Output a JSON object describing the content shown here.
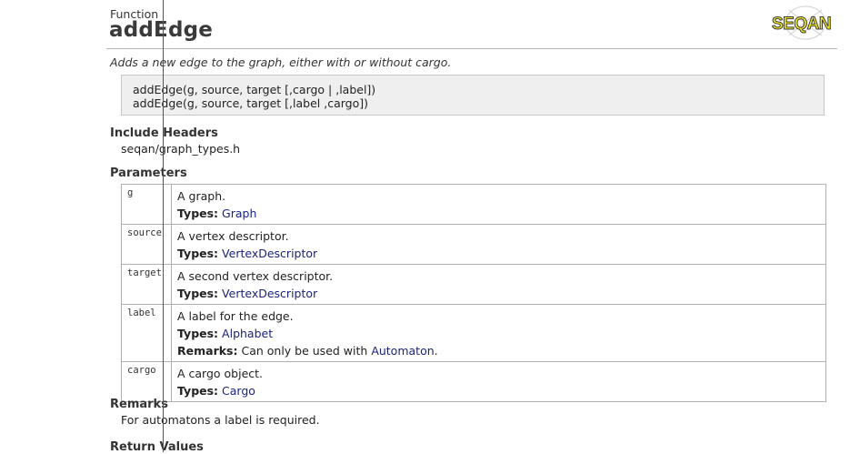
{
  "header": {
    "kind": "Function",
    "title": "addEdge",
    "logo_text": "SEQAN"
  },
  "summary": "Adds a new edge to the graph, either with or without cargo.",
  "signatures": [
    "addEdge(g, source, target [,cargo | ,label])",
    "addEdge(g, source, target [,label ,cargo])"
  ],
  "include": {
    "heading": "Include Headers",
    "file": "seqan/graph_types.h"
  },
  "parameters": {
    "heading": "Parameters",
    "types_label": "Types:",
    "remarks_label": "Remarks:",
    "rows": [
      {
        "name": "g",
        "desc": "A graph.",
        "type": "Graph"
      },
      {
        "name": "source",
        "desc": "A vertex descriptor.",
        "type": "VertexDescriptor"
      },
      {
        "name": "target",
        "desc": "A second vertex descriptor.",
        "type": "VertexDescriptor"
      },
      {
        "name": "label",
        "desc": "A label for the edge.",
        "type": "Alphabet",
        "remark_text": "Can only be used with",
        "remark_link": "Automaton",
        "remark_end": "."
      },
      {
        "name": "cargo",
        "desc": "A cargo object.",
        "type": "Cargo"
      }
    ]
  },
  "remarks": {
    "heading": "Remarks",
    "text": "For automatons a label is required."
  },
  "return_values": {
    "heading": "Return Values"
  },
  "colors": {
    "link": "#1a237e",
    "logo_yellow": "#f4ea1a",
    "logo_dark": "#3a3a3a"
  }
}
